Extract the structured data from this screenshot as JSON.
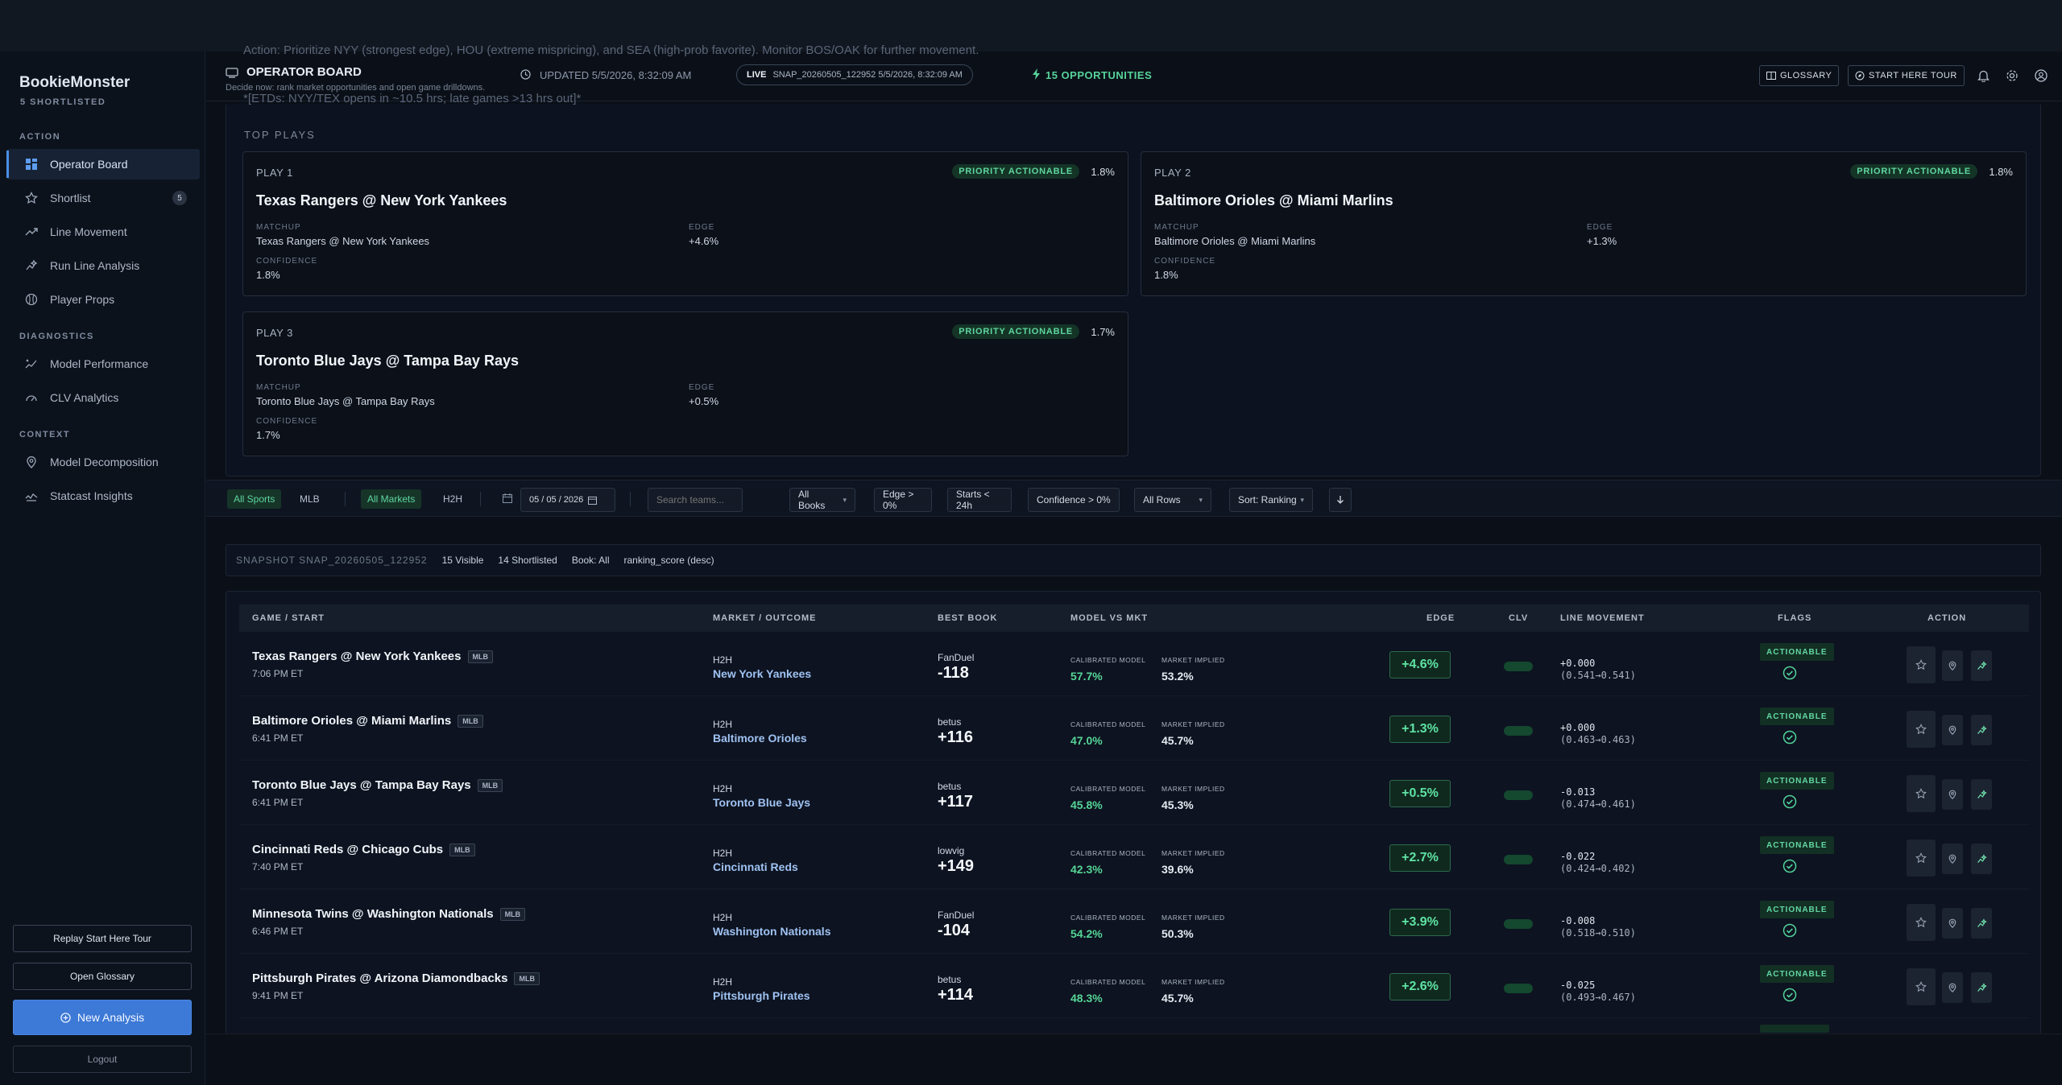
{
  "brand": {
    "name": "BookieMonster",
    "subtitle": "5 SHORTLISTED"
  },
  "sidebar": {
    "section_action": "ACTION",
    "section_diagnostics": "DIAGNOSTICS",
    "section_context": "CONTEXT",
    "items": [
      {
        "label": "Operator Board",
        "icon": "grid-icon"
      },
      {
        "label": "Shortlist",
        "icon": "star-icon",
        "count": "5"
      },
      {
        "label": "Line Movement",
        "icon": "trend-up-icon"
      },
      {
        "label": "Run Line Analysis",
        "icon": "sparkle-icon"
      },
      {
        "label": "Player Props",
        "icon": "ball-icon"
      },
      {
        "label": "Model Performance",
        "icon": "chart-icon"
      },
      {
        "label": "CLV Analytics",
        "icon": "gauge-icon"
      },
      {
        "label": "Model Decomposition",
        "icon": "pin-icon"
      },
      {
        "label": "Statcast Insights",
        "icon": "activity-icon"
      }
    ],
    "replay_tour": "Replay Start Here Tour",
    "open_glossary": "Open Glossary",
    "new_analysis": "New Analysis",
    "logout": "Logout"
  },
  "header": {
    "ghost_line1": "Action: Prioritize NYY (strongest edge), HOU (extreme mispricing), and SEA (high-prob favorite). Monitor BOS/OAK for further movement.",
    "ghost_line2": "*[ETDs: NYY/TEX opens in ~10.5 hrs; late games >13 hrs out]*",
    "title": "OPERATOR BOARD",
    "subtitle": "Decide now: rank market opportunities and open game drilldowns.",
    "updated": "UPDATED 5/5/2026, 8:32:09 AM",
    "live_label": "LIVE",
    "snapshot": "SNAP_20260505_122952  5/5/2026, 8:32:09 AM",
    "opportunities": "15 OPPORTUNITIES",
    "glossary": "GLOSSARY",
    "start_tour": "START HERE TOUR"
  },
  "top_plays": {
    "label": "TOP PLAYS",
    "matchup_label": "MATCHUP",
    "edge_label": "EDGE",
    "confidence_label": "CONFIDENCE",
    "badge": "PRIORITY ACTIONABLE",
    "plays": [
      {
        "num": "PLAY 1",
        "pct": "1.8%",
        "title": "Texas Rangers @ New York Yankees",
        "matchup": "Texas Rangers @ New York Yankees",
        "edge": "+4.6%",
        "confidence": "1.8%"
      },
      {
        "num": "PLAY 2",
        "pct": "1.8%",
        "title": "Baltimore Orioles @ Miami Marlins",
        "matchup": "Baltimore Orioles @ Miami Marlins",
        "edge": "+1.3%",
        "confidence": "1.8%"
      },
      {
        "num": "PLAY 3",
        "pct": "1.7%",
        "title": "Toronto Blue Jays @ Tampa Bay Rays",
        "matchup": "Toronto Blue Jays @ Tampa Bay Rays",
        "edge": "+0.5%",
        "confidence": "1.7%"
      }
    ]
  },
  "filters": {
    "all_sports": "All Sports",
    "mlb": "MLB",
    "all_markets": "All Markets",
    "h2h": "H2H",
    "date": "05 / 05 / 2026",
    "search_placeholder": "Search teams...",
    "books": "All Books",
    "edge": "Edge > 0%",
    "starts": "Starts < 24h",
    "confidence": "Confidence > 0%",
    "rows": "All Rows",
    "sort": "Sort: Ranking"
  },
  "snapshot_bar": {
    "snapshot": "SNAPSHOT SNAP_20260505_122952",
    "visible": "15 Visible",
    "shortlisted": "14 Shortlisted",
    "book": "Book: All",
    "sort": "ranking_score (desc)"
  },
  "table": {
    "headers": [
      "GAME / START",
      "MARKET / OUTCOME",
      "BEST BOOK",
      "MODEL VS MKT",
      "EDGE",
      "CLV",
      "LINE MOVEMENT",
      "FLAGS",
      "ACTION"
    ],
    "calibrated_label": "CALIBRATED MODEL",
    "implied_label": "MARKET IMPLIED",
    "flag_label": "ACTIONABLE",
    "clv_value": "—",
    "rows": [
      {
        "game": "Texas Rangers @ New York Yankees",
        "league": "MLB",
        "start": "7:06 PM ET",
        "market": "H2H",
        "outcome": "New York Yankees",
        "book": "FanDuel",
        "odds": "-118",
        "model": "57.7%",
        "implied": "53.2%",
        "edge": "+4.6%",
        "lm1": "+0.000",
        "lm2": "(0.541→0.541)"
      },
      {
        "game": "Baltimore Orioles @ Miami Marlins",
        "league": "MLB",
        "start": "6:41 PM ET",
        "market": "H2H",
        "outcome": "Baltimore Orioles",
        "book": "betus",
        "odds": "+116",
        "model": "47.0%",
        "implied": "45.7%",
        "edge": "+1.3%",
        "lm1": "+0.000",
        "lm2": "(0.463→0.463)"
      },
      {
        "game": "Toronto Blue Jays @ Tampa Bay Rays",
        "league": "MLB",
        "start": "6:41 PM ET",
        "market": "H2H",
        "outcome": "Toronto Blue Jays",
        "book": "betus",
        "odds": "+117",
        "model": "45.8%",
        "implied": "45.3%",
        "edge": "+0.5%",
        "lm1": "-0.013",
        "lm2": "(0.474→0.461)"
      },
      {
        "game": "Cincinnati Reds @ Chicago Cubs",
        "league": "MLB",
        "start": "7:40 PM ET",
        "market": "H2H",
        "outcome": "Cincinnati Reds",
        "book": "lowvig",
        "odds": "+149",
        "model": "42.3%",
        "implied": "39.6%",
        "edge": "+2.7%",
        "lm1": "-0.022",
        "lm2": "(0.424→0.402)"
      },
      {
        "game": "Minnesota Twins @ Washington Nationals",
        "league": "MLB",
        "start": "6:46 PM ET",
        "market": "H2H",
        "outcome": "Washington Nationals",
        "book": "FanDuel",
        "odds": "-104",
        "model": "54.2%",
        "implied": "50.3%",
        "edge": "+3.9%",
        "lm1": "-0.008",
        "lm2": "(0.518→0.510)"
      },
      {
        "game": "Pittsburgh Pirates @ Arizona Diamondbacks",
        "league": "MLB",
        "start": "9:41 PM ET",
        "market": "H2H",
        "outcome": "Pittsburgh Pirates",
        "book": "betus",
        "odds": "+114",
        "model": "48.3%",
        "implied": "45.7%",
        "edge": "+2.6%",
        "lm1": "-0.025",
        "lm2": "(0.493→0.467)"
      }
    ]
  },
  "colors": {
    "accent": "#3d79d6",
    "positive": "#5ee3a3",
    "background": "#0b1018"
  }
}
